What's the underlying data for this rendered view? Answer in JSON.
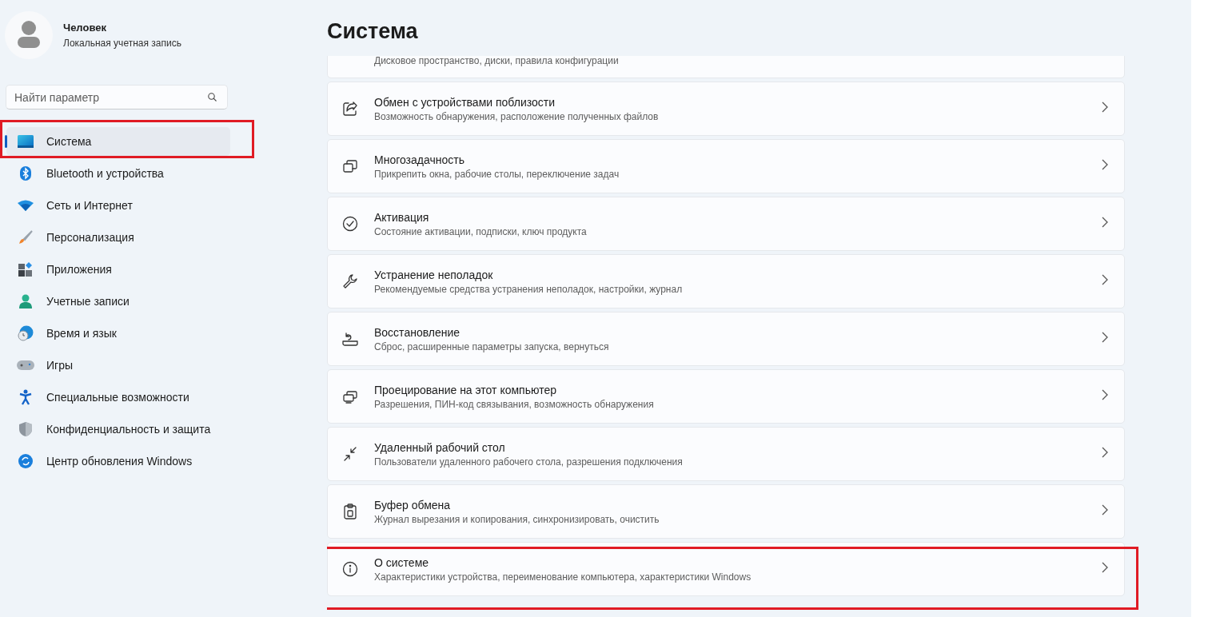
{
  "profile": {
    "name": "Человек",
    "account": "Локальная учетная запись"
  },
  "search": {
    "placeholder": "Найти параметр"
  },
  "nav": {
    "items": [
      {
        "label": "Система",
        "selected": true,
        "highlighted": true
      },
      {
        "label": "Bluetooth и устройства",
        "selected": false,
        "highlighted": false
      },
      {
        "label": "Сеть и Интернет",
        "selected": false,
        "highlighted": false
      },
      {
        "label": "Персонализация",
        "selected": false,
        "highlighted": false
      },
      {
        "label": "Приложения",
        "selected": false,
        "highlighted": false
      },
      {
        "label": "Учетные записи",
        "selected": false,
        "highlighted": false
      },
      {
        "label": "Время и язык",
        "selected": false,
        "highlighted": false
      },
      {
        "label": "Игры",
        "selected": false,
        "highlighted": false
      },
      {
        "label": "Специальные возможности",
        "selected": false,
        "highlighted": false
      },
      {
        "label": "Конфиденциальность и защита",
        "selected": false,
        "highlighted": false
      },
      {
        "label": "Центр обновления Windows",
        "selected": false,
        "highlighted": false
      }
    ]
  },
  "page_title": "Система",
  "cards": [
    {
      "kind": "clipped",
      "subtitle": "Дисковое пространство, диски, правила конфигурации",
      "highlighted": false
    },
    {
      "kind": "full",
      "title": "Обмен с устройствами поблизости",
      "subtitle": "Возможность обнаружения, расположение полученных файлов",
      "highlighted": false
    },
    {
      "kind": "full",
      "title": "Многозадачность",
      "subtitle": "Прикрепить окна, рабочие столы, переключение задач",
      "highlighted": false
    },
    {
      "kind": "full",
      "title": "Активация",
      "subtitle": "Состояние активации, подписки, ключ продукта",
      "highlighted": false
    },
    {
      "kind": "full",
      "title": "Устранение неполадок",
      "subtitle": "Рекомендуемые средства устранения неполадок, настройки, журнал",
      "highlighted": false
    },
    {
      "kind": "full",
      "title": "Восстановление",
      "subtitle": "Сброс, расширенные параметры запуска, вернуться",
      "highlighted": false
    },
    {
      "kind": "full",
      "title": "Проецирование на этот компьютер",
      "subtitle": "Разрешения, ПИН-код связывания, возможность обнаружения",
      "highlighted": false
    },
    {
      "kind": "full",
      "title": "Удаленный рабочий стол",
      "subtitle": "Пользователи удаленного рабочего стола, разрешения подключения",
      "highlighted": false
    },
    {
      "kind": "full",
      "title": "Буфер обмена",
      "subtitle": "Журнал вырезания и копирования, синхронизировать, очистить",
      "highlighted": false
    },
    {
      "kind": "full",
      "title": "О системе",
      "subtitle": "Характеристики устройства, переименование компьютера, характеристики Windows",
      "highlighted": true
    }
  ]
}
